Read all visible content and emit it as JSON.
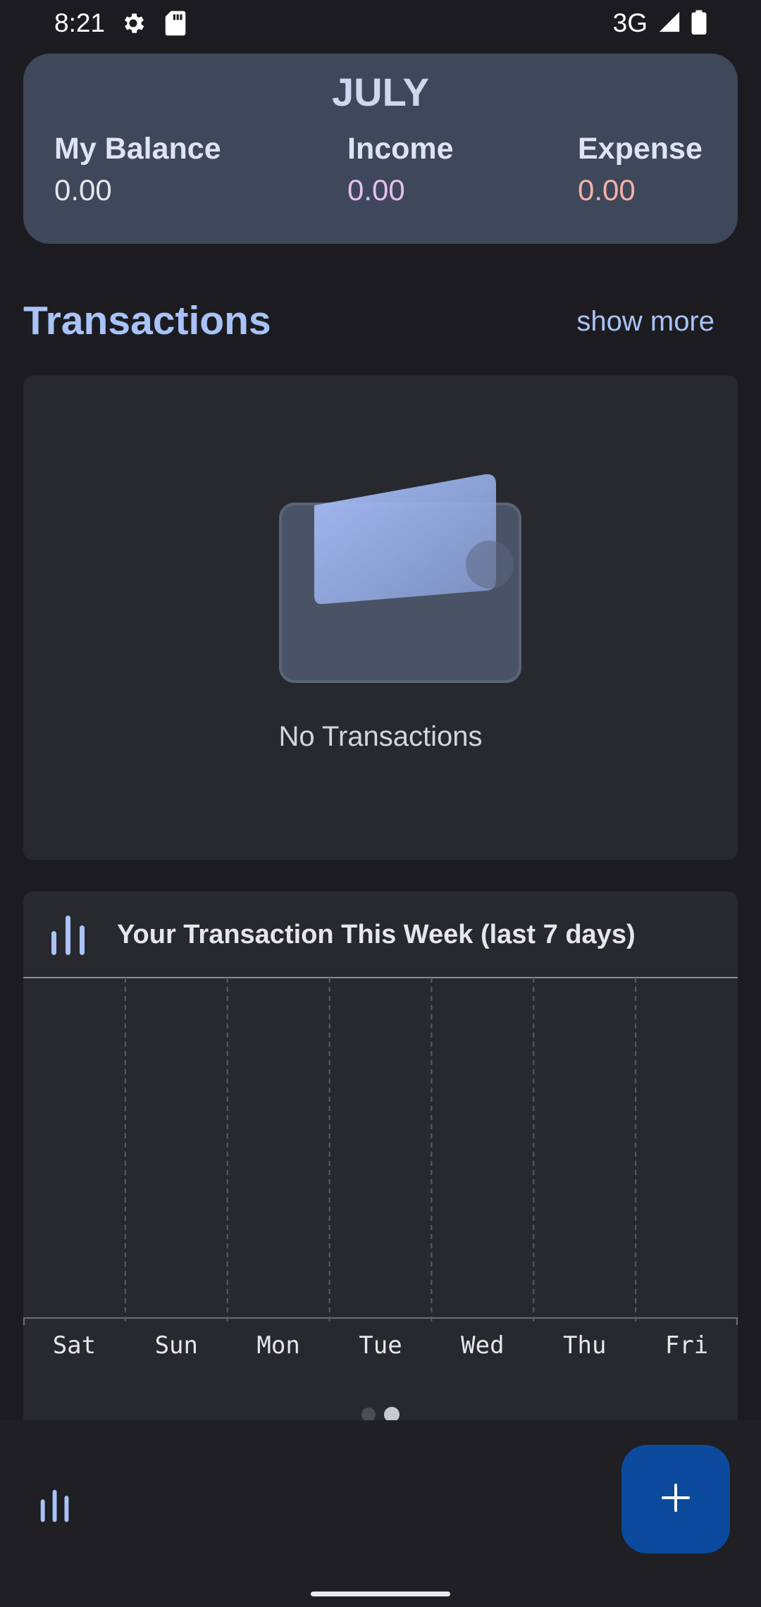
{
  "status_bar": {
    "time": "8:21",
    "network": "3G",
    "icons": [
      "settings-icon",
      "sd-card-icon",
      "signal-icon",
      "battery-icon"
    ]
  },
  "summary": {
    "month": "JULY",
    "balance_label": "My Balance",
    "balance_value": "0.00",
    "income_label": "Income",
    "income_value": "0.00",
    "expense_label": "Expense",
    "expense_value": "0.00"
  },
  "transactions": {
    "title": "Transactions",
    "show_more": "show more",
    "empty_message": "No Transactions"
  },
  "weekly_chart": {
    "title": "Your Transaction This Week (last 7 days)",
    "icon": "bar-chart-icon"
  },
  "chart_data": {
    "type": "bar",
    "categories": [
      "Sat",
      "Sun",
      "Mon",
      "Tue",
      "Wed",
      "Thu",
      "Fri"
    ],
    "values": [
      0,
      0,
      0,
      0,
      0,
      0,
      0
    ],
    "title": "Your Transaction This Week (last 7 days)",
    "grid": true
  },
  "pagination": {
    "count": 2,
    "active": 1
  },
  "bottom_nav": {
    "stats_icon": "bar-chart-icon",
    "fab_icon": "plus-icon"
  },
  "colors": {
    "background": "#1c1c20",
    "card": "#28292e",
    "summary_card": "#3f475a",
    "accent": "#a9c2f7",
    "income": "#e6bff0",
    "expense": "#f4b1a6",
    "fab": "#0b4a9c"
  }
}
